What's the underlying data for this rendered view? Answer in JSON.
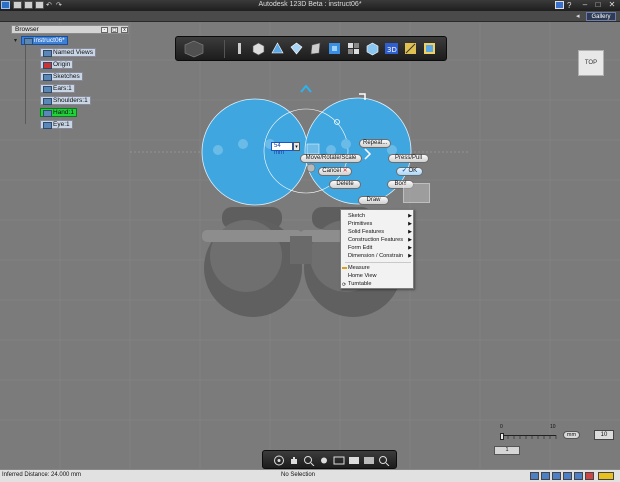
{
  "window": {
    "title": "Autodesk 123D Beta : instruct06*",
    "gallery_label": "Gallery"
  },
  "browser": {
    "header": "Browser",
    "root_label": "instruct06*",
    "items": [
      {
        "label": "Named Views"
      },
      {
        "label": "Origin"
      },
      {
        "label": "Sketches"
      },
      {
        "label": "Ears:1"
      },
      {
        "label": "Shoulders:1"
      },
      {
        "label": "Hand:1"
      },
      {
        "label": "Eye:1"
      }
    ]
  },
  "viewcube": {
    "label": "TOP"
  },
  "dimension": {
    "value": "54 mm"
  },
  "context_buttons": {
    "move": "Move/Rotate/Scale",
    "repeat": "Repeat...",
    "press_pull": "Press/Pull",
    "cancel": "Cancel",
    "ok": "OK",
    "delete": "Delete",
    "bool": "Bool",
    "draw": "Draw"
  },
  "marking_menu": {
    "items": [
      {
        "label": "Sketch",
        "submenu": true
      },
      {
        "label": "Primitives",
        "submenu": true
      },
      {
        "label": "Solid Features",
        "submenu": true
      },
      {
        "label": "Construction Features",
        "submenu": true
      },
      {
        "label": "Form Edit",
        "submenu": true
      },
      {
        "label": "Dimension / Constrain",
        "submenu": true
      }
    ],
    "items2": [
      {
        "label": "Measure"
      },
      {
        "label": "Home View"
      },
      {
        "label": "Turntable"
      }
    ]
  },
  "grid": {
    "slider_min": "0",
    "slider_max": "10",
    "slider_value_fraction": 0.0,
    "unit": "mm",
    "snap_value": "10",
    "grid_value": "1"
  },
  "status": {
    "left": "Inferred Distance: 24.000 mm",
    "middle": "No Selection"
  },
  "colors": {
    "accent_blue": "#3fa6e0",
    "selection_green": "#1fd23a",
    "viewport_gray": "#7b7b7b"
  }
}
